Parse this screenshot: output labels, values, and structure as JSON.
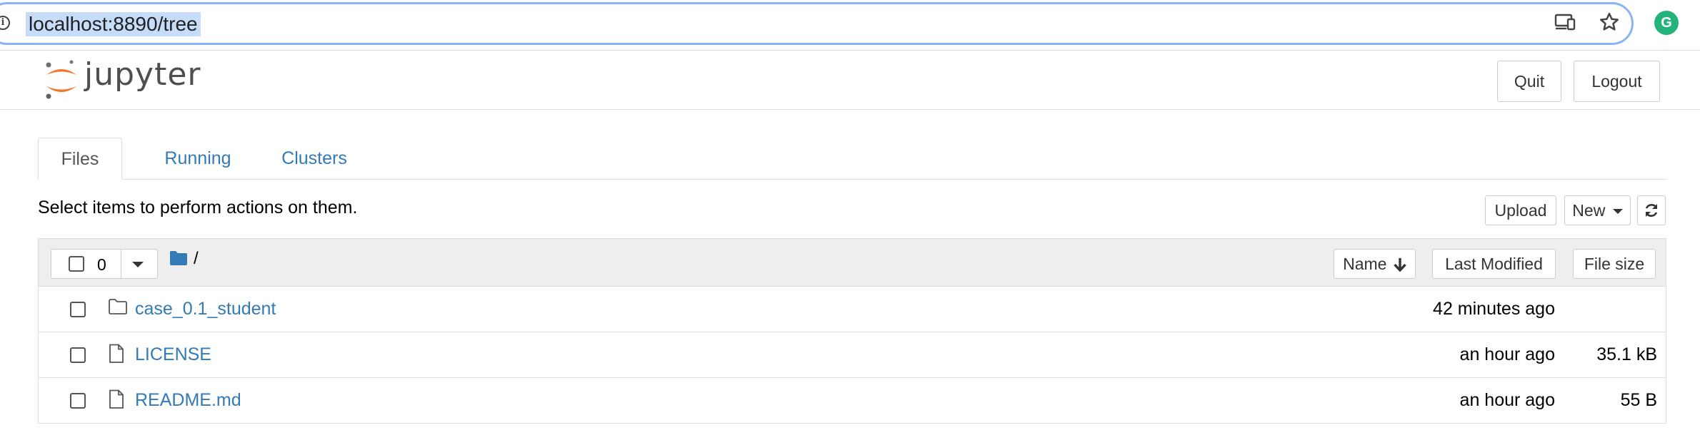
{
  "browser": {
    "url": "localhost:8890/tree",
    "avatar_letter": "G",
    "icons": [
      "info-icon",
      "cast-icon",
      "bookmark-star-icon",
      "profile-avatar"
    ]
  },
  "header": {
    "logo_text": "jupyter",
    "quit_label": "Quit",
    "logout_label": "Logout"
  },
  "tabs": [
    {
      "label": "Files",
      "active": true
    },
    {
      "label": "Running",
      "active": false
    },
    {
      "label": "Clusters",
      "active": false
    }
  ],
  "toolbar": {
    "hint": "Select items to perform actions on them.",
    "upload_label": "Upload",
    "new_label": "New",
    "refresh_icon": "refresh-icon"
  },
  "list_header": {
    "selected_count": "0",
    "path": "/",
    "sort_name_label": "Name",
    "sort_modified_label": "Last Modified",
    "sort_size_label": "File size"
  },
  "files": [
    {
      "name": "case_0.1_student",
      "type": "folder",
      "modified": "42 minutes ago",
      "size": ""
    },
    {
      "name": "LICENSE",
      "type": "file",
      "modified": "an hour ago",
      "size": "35.1 kB"
    },
    {
      "name": "README.md",
      "type": "file",
      "modified": "an hour ago",
      "size": "55 B"
    }
  ],
  "colors": {
    "link": "#337ab7",
    "logo_orange": "#f37726",
    "url_highlight": "#c7dcf8",
    "avatar_green": "#24b37b",
    "header_bg": "#eeeeee"
  }
}
